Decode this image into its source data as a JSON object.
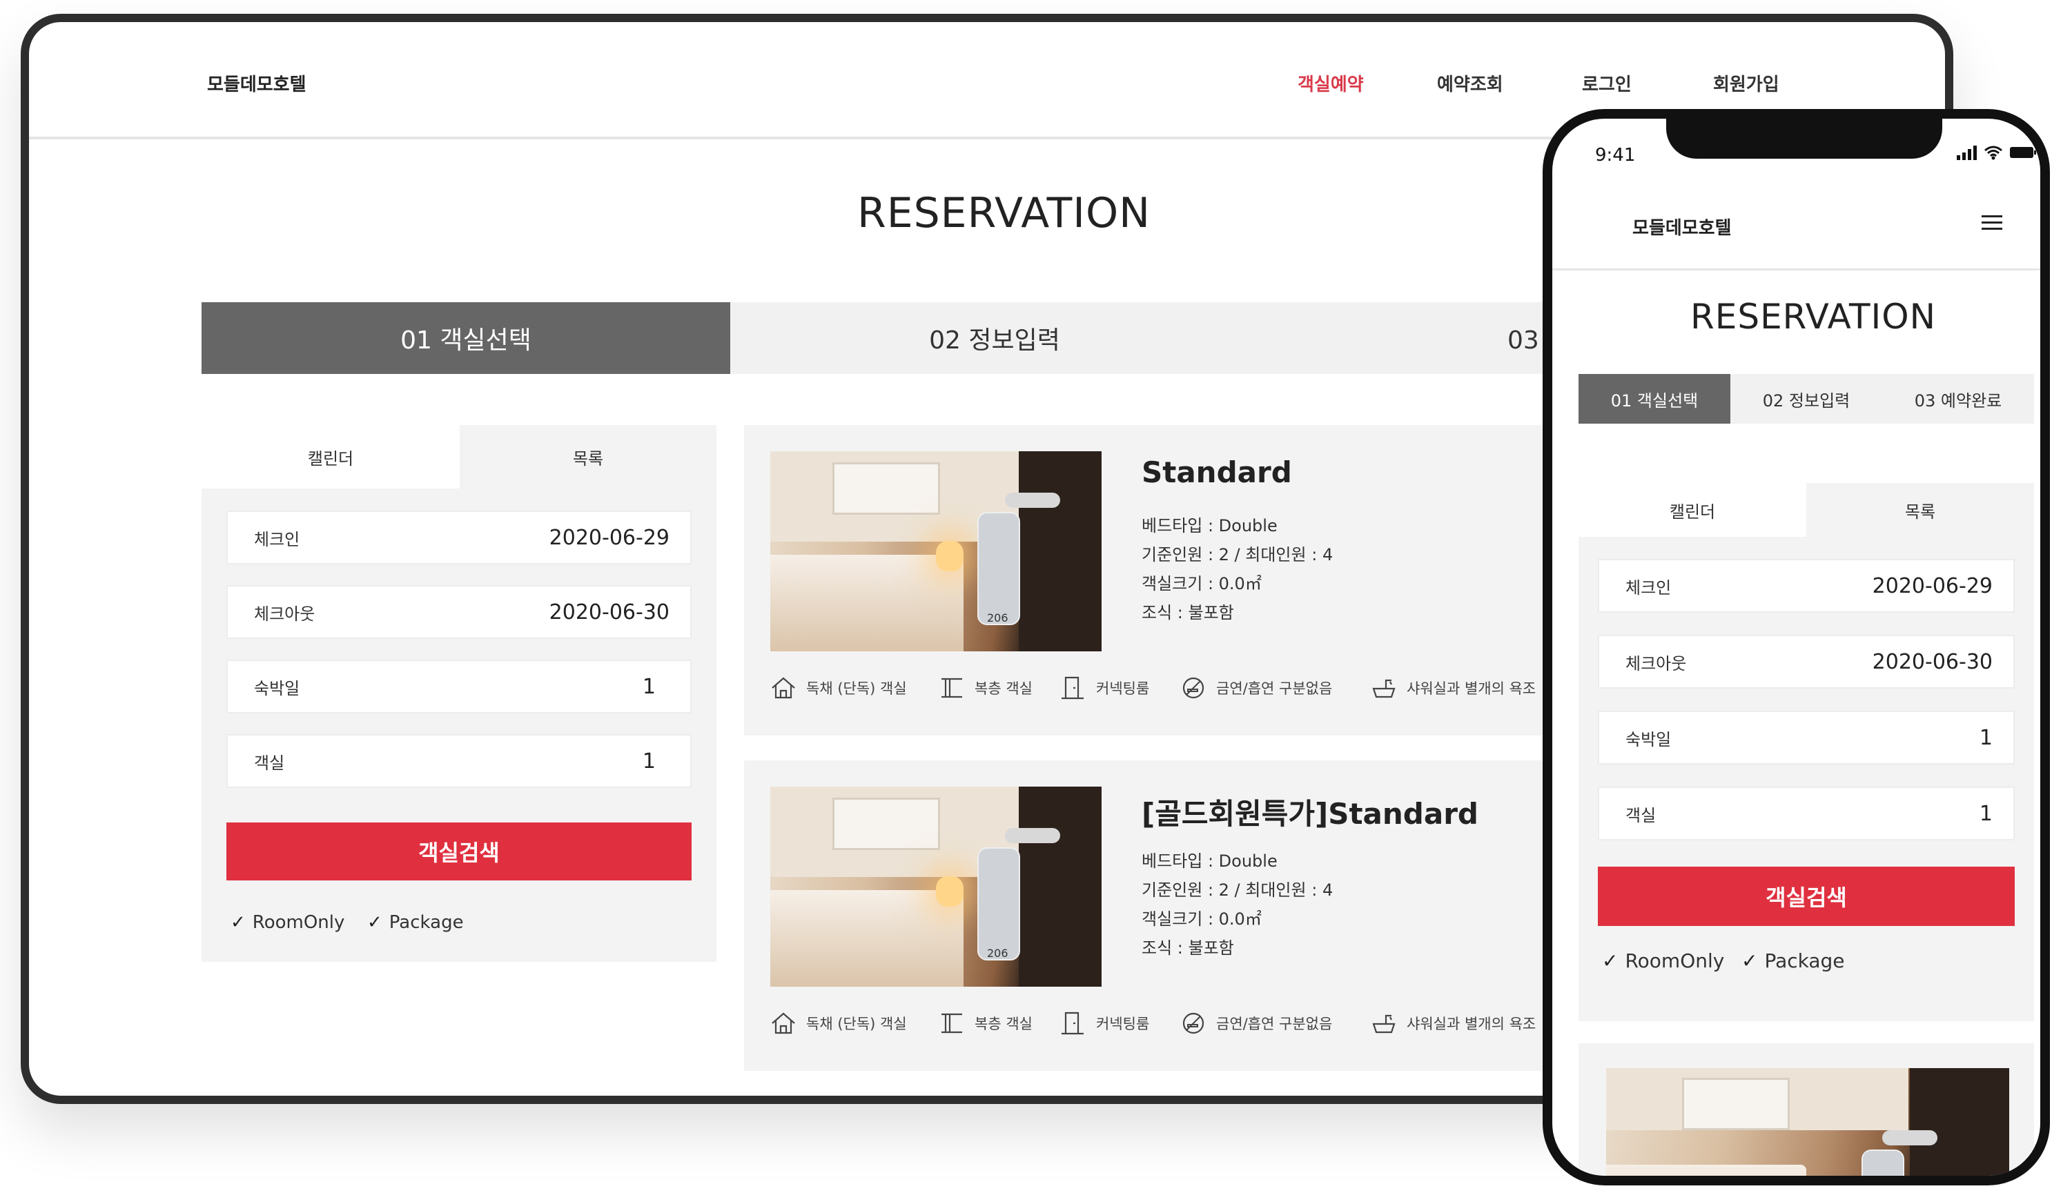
{
  "desktop": {
    "brand": "모들데모호텔",
    "nav": [
      "객실예약",
      "예약조회",
      "로그인",
      "회원가입"
    ],
    "title": "RESERVATION",
    "steps": [
      "01 객실선택",
      "02 정보입력",
      "03 예약완료"
    ],
    "tabs": [
      "캘린더",
      "목록"
    ],
    "fields": [
      {
        "label": "체크인",
        "value": "2020-06-29"
      },
      {
        "label": "체크아웃",
        "value": "2020-06-30"
      },
      {
        "label": "숙박일",
        "value": "1"
      },
      {
        "label": "객실",
        "value": "1"
      }
    ],
    "search_label": "객실검색",
    "options": [
      "RoomOnly",
      "Package"
    ],
    "rooms": [
      {
        "name": "Standard",
        "bed": "베드타입 : Double",
        "capacity": "기준인원 : 2  /  최대인원 : 4",
        "size": "객실크기 : 0.0㎡",
        "breakfast": "조식 : 불포함",
        "tag_number": "206"
      },
      {
        "name": "[골드회원특가]Standard",
        "bed": "베드타입 : Double",
        "capacity": "기준인원 : 2  /  최대인원 : 4",
        "size": "객실크기 : 0.0㎡",
        "breakfast": "조식 : 불포함",
        "tag_number": "206"
      }
    ],
    "amenities": [
      "독채 (단독) 객실",
      "복층 객실",
      "커넥팅룸",
      "금연/흡연 구분없음",
      "샤워실과 별개의 욕조"
    ]
  },
  "mobile": {
    "time": "9:41",
    "brand": "모들데모호텔",
    "title": "RESERVATION",
    "steps": [
      "01 객실선택",
      "02 정보입력",
      "03 예약완료"
    ],
    "tabs": [
      "캘린더",
      "목록"
    ],
    "fields": [
      {
        "label": "체크인",
        "value": "2020-06-29"
      },
      {
        "label": "체크아웃",
        "value": "2020-06-30"
      },
      {
        "label": "숙박일",
        "value": "1"
      },
      {
        "label": "객실",
        "value": "1"
      }
    ],
    "search_label": "객실검색",
    "options": [
      "RoomOnly",
      "Package"
    ]
  },
  "colors": {
    "accent": "#e0303f",
    "active_nav": "#d93a4a",
    "active_step": "#666666"
  }
}
